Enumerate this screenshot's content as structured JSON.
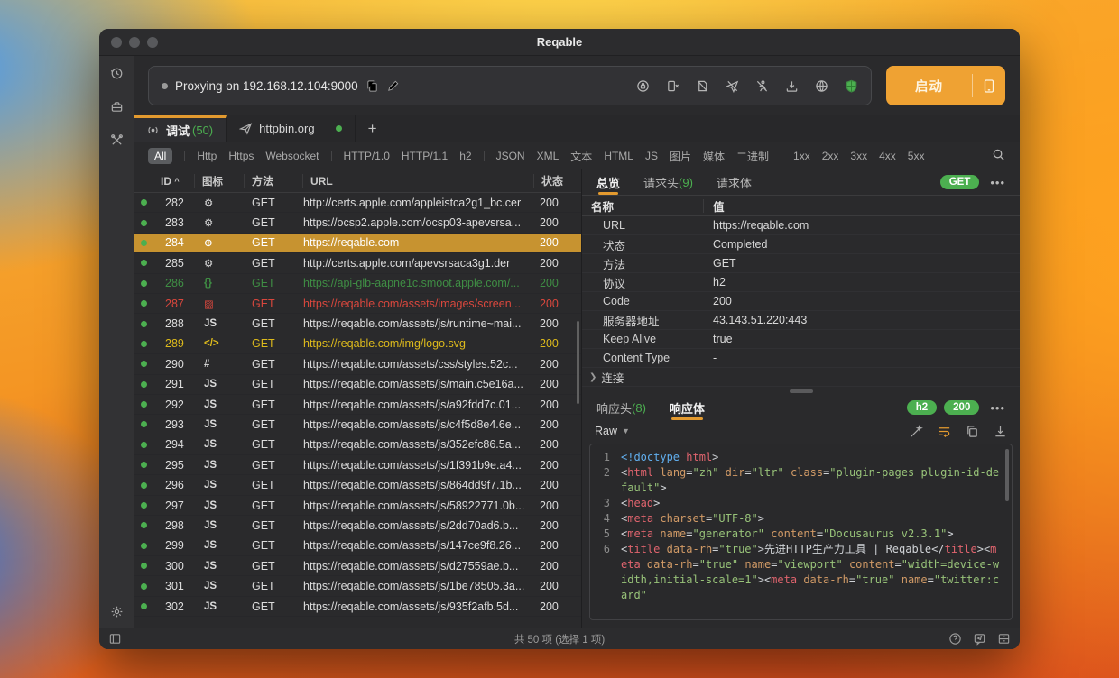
{
  "window": {
    "title": "Reqable"
  },
  "sidebar": {
    "icons": [
      "history-icon",
      "toolbox-icon",
      "tools-icon",
      "settings-icon"
    ]
  },
  "toolbar": {
    "proxy_status": "Proxying on 192.168.12.104:9000",
    "icons": [
      "shield-lock-icon",
      "phone-disconnect-icon",
      "script-off-icon",
      "send-off-icon",
      "run-off-icon",
      "download-icon",
      "network-icon",
      "security-on-icon"
    ],
    "start_label": "启动"
  },
  "session_tabs": {
    "debug": {
      "label": "调试",
      "count": "(50)"
    },
    "remote": {
      "label": "httpbin.org"
    },
    "add": "+"
  },
  "filters": {
    "selected": "All",
    "items": [
      "All",
      "Http",
      "Https",
      "Websocket",
      "HTTP/1.0",
      "HTTP/1.1",
      "h2",
      "JSON",
      "XML",
      "文本",
      "HTML",
      "JS",
      "图片",
      "媒体",
      "二进制",
      "1xx",
      "2xx",
      "3xx",
      "4xx",
      "5xx"
    ],
    "separator_after": [
      0,
      3,
      6,
      14
    ]
  },
  "request_table": {
    "columns": {
      "id": "ID",
      "icon": "图标",
      "method": "方法",
      "url": "URL",
      "status": "状态"
    },
    "rows": [
      {
        "id": "282",
        "icon": "gear",
        "method": "GET",
        "url": "http://certs.apple.com/appleistca2g1_bc.cer",
        "status": "200",
        "state": ""
      },
      {
        "id": "283",
        "icon": "gear",
        "method": "GET",
        "url": "https://ocsp2.apple.com/ocsp03-apevsrsa...",
        "status": "200",
        "state": ""
      },
      {
        "id": "284",
        "icon": "globe",
        "method": "GET",
        "url": "https://reqable.com",
        "status": "200",
        "state": "sel"
      },
      {
        "id": "285",
        "icon": "gear",
        "method": "GET",
        "url": "http://certs.apple.com/apevsrsaca3g1.der",
        "status": "200",
        "state": ""
      },
      {
        "id": "286",
        "icon": "braces",
        "method": "GET",
        "url": "https://api-glb-aapne1c.smoot.apple.com/...",
        "status": "200",
        "state": "green"
      },
      {
        "id": "287",
        "icon": "image",
        "method": "GET",
        "url": "https://reqable.com/assets/images/screen...",
        "status": "200",
        "state": "red"
      },
      {
        "id": "288",
        "icon": "js",
        "method": "GET",
        "url": "https://reqable.com/assets/js/runtime~mai...",
        "status": "200",
        "state": ""
      },
      {
        "id": "289",
        "icon": "code",
        "method": "GET",
        "url": "https://reqable.com/img/logo.svg",
        "status": "200",
        "state": "yellow"
      },
      {
        "id": "290",
        "icon": "hash",
        "method": "GET",
        "url": "https://reqable.com/assets/css/styles.52c...",
        "status": "200",
        "state": ""
      },
      {
        "id": "291",
        "icon": "js",
        "method": "GET",
        "url": "https://reqable.com/assets/js/main.c5e16a...",
        "status": "200",
        "state": ""
      },
      {
        "id": "292",
        "icon": "js",
        "method": "GET",
        "url": "https://reqable.com/assets/js/a92fdd7c.01...",
        "status": "200",
        "state": ""
      },
      {
        "id": "293",
        "icon": "js",
        "method": "GET",
        "url": "https://reqable.com/assets/js/c4f5d8e4.6e...",
        "status": "200",
        "state": ""
      },
      {
        "id": "294",
        "icon": "js",
        "method": "GET",
        "url": "https://reqable.com/assets/js/352efc86.5a...",
        "status": "200",
        "state": ""
      },
      {
        "id": "295",
        "icon": "js",
        "method": "GET",
        "url": "https://reqable.com/assets/js/1f391b9e.a4...",
        "status": "200",
        "state": ""
      },
      {
        "id": "296",
        "icon": "js",
        "method": "GET",
        "url": "https://reqable.com/assets/js/864dd9f7.1b...",
        "status": "200",
        "state": ""
      },
      {
        "id": "297",
        "icon": "js",
        "method": "GET",
        "url": "https://reqable.com/assets/js/58922771.0b...",
        "status": "200",
        "state": ""
      },
      {
        "id": "298",
        "icon": "js",
        "method": "GET",
        "url": "https://reqable.com/assets/js/2dd70ad6.b...",
        "status": "200",
        "state": ""
      },
      {
        "id": "299",
        "icon": "js",
        "method": "GET",
        "url": "https://reqable.com/assets/js/147ce9f8.26...",
        "status": "200",
        "state": ""
      },
      {
        "id": "300",
        "icon": "js",
        "method": "GET",
        "url": "https://reqable.com/assets/js/d27559ae.b...",
        "status": "200",
        "state": ""
      },
      {
        "id": "301",
        "icon": "js",
        "method": "GET",
        "url": "https://reqable.com/assets/js/1be78505.3a...",
        "status": "200",
        "state": ""
      },
      {
        "id": "302",
        "icon": "js",
        "method": "GET",
        "url": "https://reqable.com/assets/js/935f2afb.5d...",
        "status": "200",
        "state": ""
      }
    ]
  },
  "icon_glyphs": {
    "gear": "⚙",
    "globe": "⊕",
    "braces": "{}",
    "image": "▨",
    "js": "JS",
    "code": "</>",
    "hash": "#"
  },
  "overview": {
    "tabs": [
      {
        "label": "总览",
        "count": "",
        "active": true
      },
      {
        "label": "请求头",
        "count": "(9)",
        "active": false
      },
      {
        "label": "请求体",
        "count": "",
        "active": false
      }
    ],
    "method_badge": "GET",
    "more": "•••",
    "columns": {
      "name": "名称",
      "value": "值"
    },
    "rows": [
      {
        "name": "URL",
        "value": "https://reqable.com"
      },
      {
        "name": "状态",
        "value": "Completed"
      },
      {
        "name": "方法",
        "value": "GET"
      },
      {
        "name": "协议",
        "value": "h2"
      },
      {
        "name": "Code",
        "value": "200"
      },
      {
        "name": "服务器地址",
        "value": "43.143.51.220:443"
      },
      {
        "name": "Keep Alive",
        "value": "true"
      },
      {
        "name": "Content Type",
        "value": "-"
      },
      {
        "name": "连接",
        "value": "",
        "expandable": true
      }
    ]
  },
  "response": {
    "tabs": [
      {
        "label": "响应头",
        "count": "(8)",
        "active": false
      },
      {
        "label": "响应体",
        "count": "",
        "active": true
      }
    ],
    "badges": [
      "h2",
      "200"
    ],
    "more": "•••",
    "view_mode": "Raw",
    "code_lines": [
      {
        "num": "1",
        "text": "<!doctype html>"
      },
      {
        "num": "2",
        "text": "<html lang=\"zh\" dir=\"ltr\" class=\"plugin-pages plugin-id-default\">"
      },
      {
        "num": "3",
        "text": "<head>"
      },
      {
        "num": "4",
        "text": "<meta charset=\"UTF-8\">"
      },
      {
        "num": "5",
        "text": "<meta name=\"generator\" content=\"Docusaurus v2.3.1\">"
      },
      {
        "num": "6",
        "text": "<title data-rh=\"true\">先进HTTP生产力工具 | Reqable</title><meta data-rh=\"true\" name=\"viewport\" content=\"width=device-width,initial-scale=1\"><meta data-rh=\"true\" name=\"twitter:card\""
      }
    ]
  },
  "status_bar": {
    "summary": "共 50 项 (选择 1 项)"
  },
  "colors": {
    "accent_orange": "#E39A2F",
    "green": "#4CAF50",
    "selected_row": "#C79330",
    "red": "#D9473D",
    "yellow": "#DDBA1C"
  }
}
